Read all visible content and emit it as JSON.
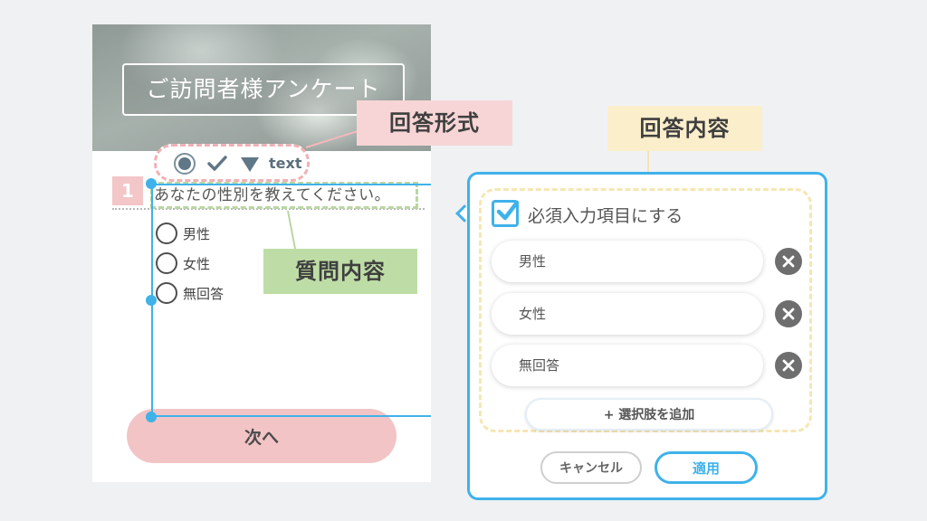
{
  "survey": {
    "title": "ご訪問者様アンケート",
    "answer_types": {
      "text_label": "text"
    },
    "question": {
      "number": "1",
      "text": "あなたの性別を教えてください。",
      "options": [
        "男性",
        "女性",
        "無回答"
      ]
    },
    "next_label": "次へ"
  },
  "callouts": {
    "answer_format": "回答形式",
    "question_content": "質問内容",
    "answer_content": "回答内容"
  },
  "panel": {
    "required_label": "必須入力項目にする",
    "required_checked": true,
    "choices": [
      "男性",
      "女性",
      "無回答"
    ],
    "add_choice_label": "+ 選択肢を追加",
    "cancel_label": "キャンセル",
    "apply_label": "適用"
  },
  "colors": {
    "accent_blue": "#3fb2ea",
    "pink": "#f2c4c5",
    "green": "#bedda6",
    "yellow": "#fbeecb"
  }
}
